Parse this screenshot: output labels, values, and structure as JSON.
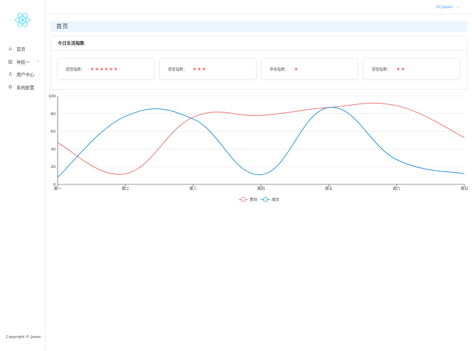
{
  "sidebar": {
    "items": [
      {
        "label": "首页",
        "icon": "home-icon"
      },
      {
        "label": "导航一",
        "icon": "chart-icon"
      },
      {
        "label": "用户中心",
        "icon": "user-icon"
      },
      {
        "label": "系统配置",
        "icon": "gear-icon"
      }
    ],
    "copyright": "Copyright © Jason"
  },
  "header": {
    "user": "Hi Jason"
  },
  "breadcrumb": "首页",
  "card": {
    "title": "今日生活指数",
    "indices": [
      {
        "label": "感冒指数：",
        "stars": "★★★★★★",
        "count": 6
      },
      {
        "label": "感冒指数：",
        "stars": "★★★",
        "count": 3
      },
      {
        "label": "穿衣指数：",
        "stars": "★",
        "count": 1
      },
      {
        "label": "感冒指数：",
        "stars": "★★",
        "count": 2
      }
    ]
  },
  "chart_data": {
    "type": "line",
    "categories": [
      "周一",
      "周二",
      "周三",
      "周四",
      "周五",
      "周六",
      "周日"
    ],
    "ylim": [
      0,
      100
    ],
    "yticks": [
      0,
      20,
      40,
      60,
      80,
      100
    ],
    "legend": "bottom-center",
    "smooth": true,
    "series": [
      {
        "name": "意向",
        "color": "#e5736e",
        "values": [
          47,
          12,
          76,
          78,
          87,
          89,
          53
        ]
      },
      {
        "name": "成交",
        "color": "#1f8fd6",
        "values": [
          8,
          77,
          74,
          11,
          87,
          28,
          12
        ]
      }
    ]
  }
}
